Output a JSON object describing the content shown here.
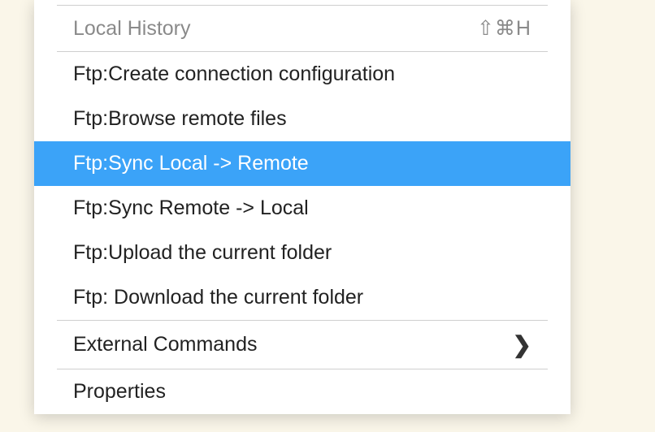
{
  "menu": {
    "local_history": {
      "label": "Local History",
      "shortcut": "⇧⌘H"
    },
    "ftp_items": [
      {
        "label": "Ftp:Create connection configuration",
        "highlighted": false
      },
      {
        "label": "Ftp:Browse remote files",
        "highlighted": false
      },
      {
        "label": "Ftp:Sync Local -> Remote",
        "highlighted": true
      },
      {
        "label": "Ftp:Sync Remote -> Local",
        "highlighted": false
      },
      {
        "label": "Ftp:Upload the current folder",
        "highlighted": false
      },
      {
        "label": "Ftp: Download the current folder",
        "highlighted": false
      }
    ],
    "external_commands": {
      "label": "External Commands"
    },
    "properties": {
      "label": "Properties"
    }
  }
}
